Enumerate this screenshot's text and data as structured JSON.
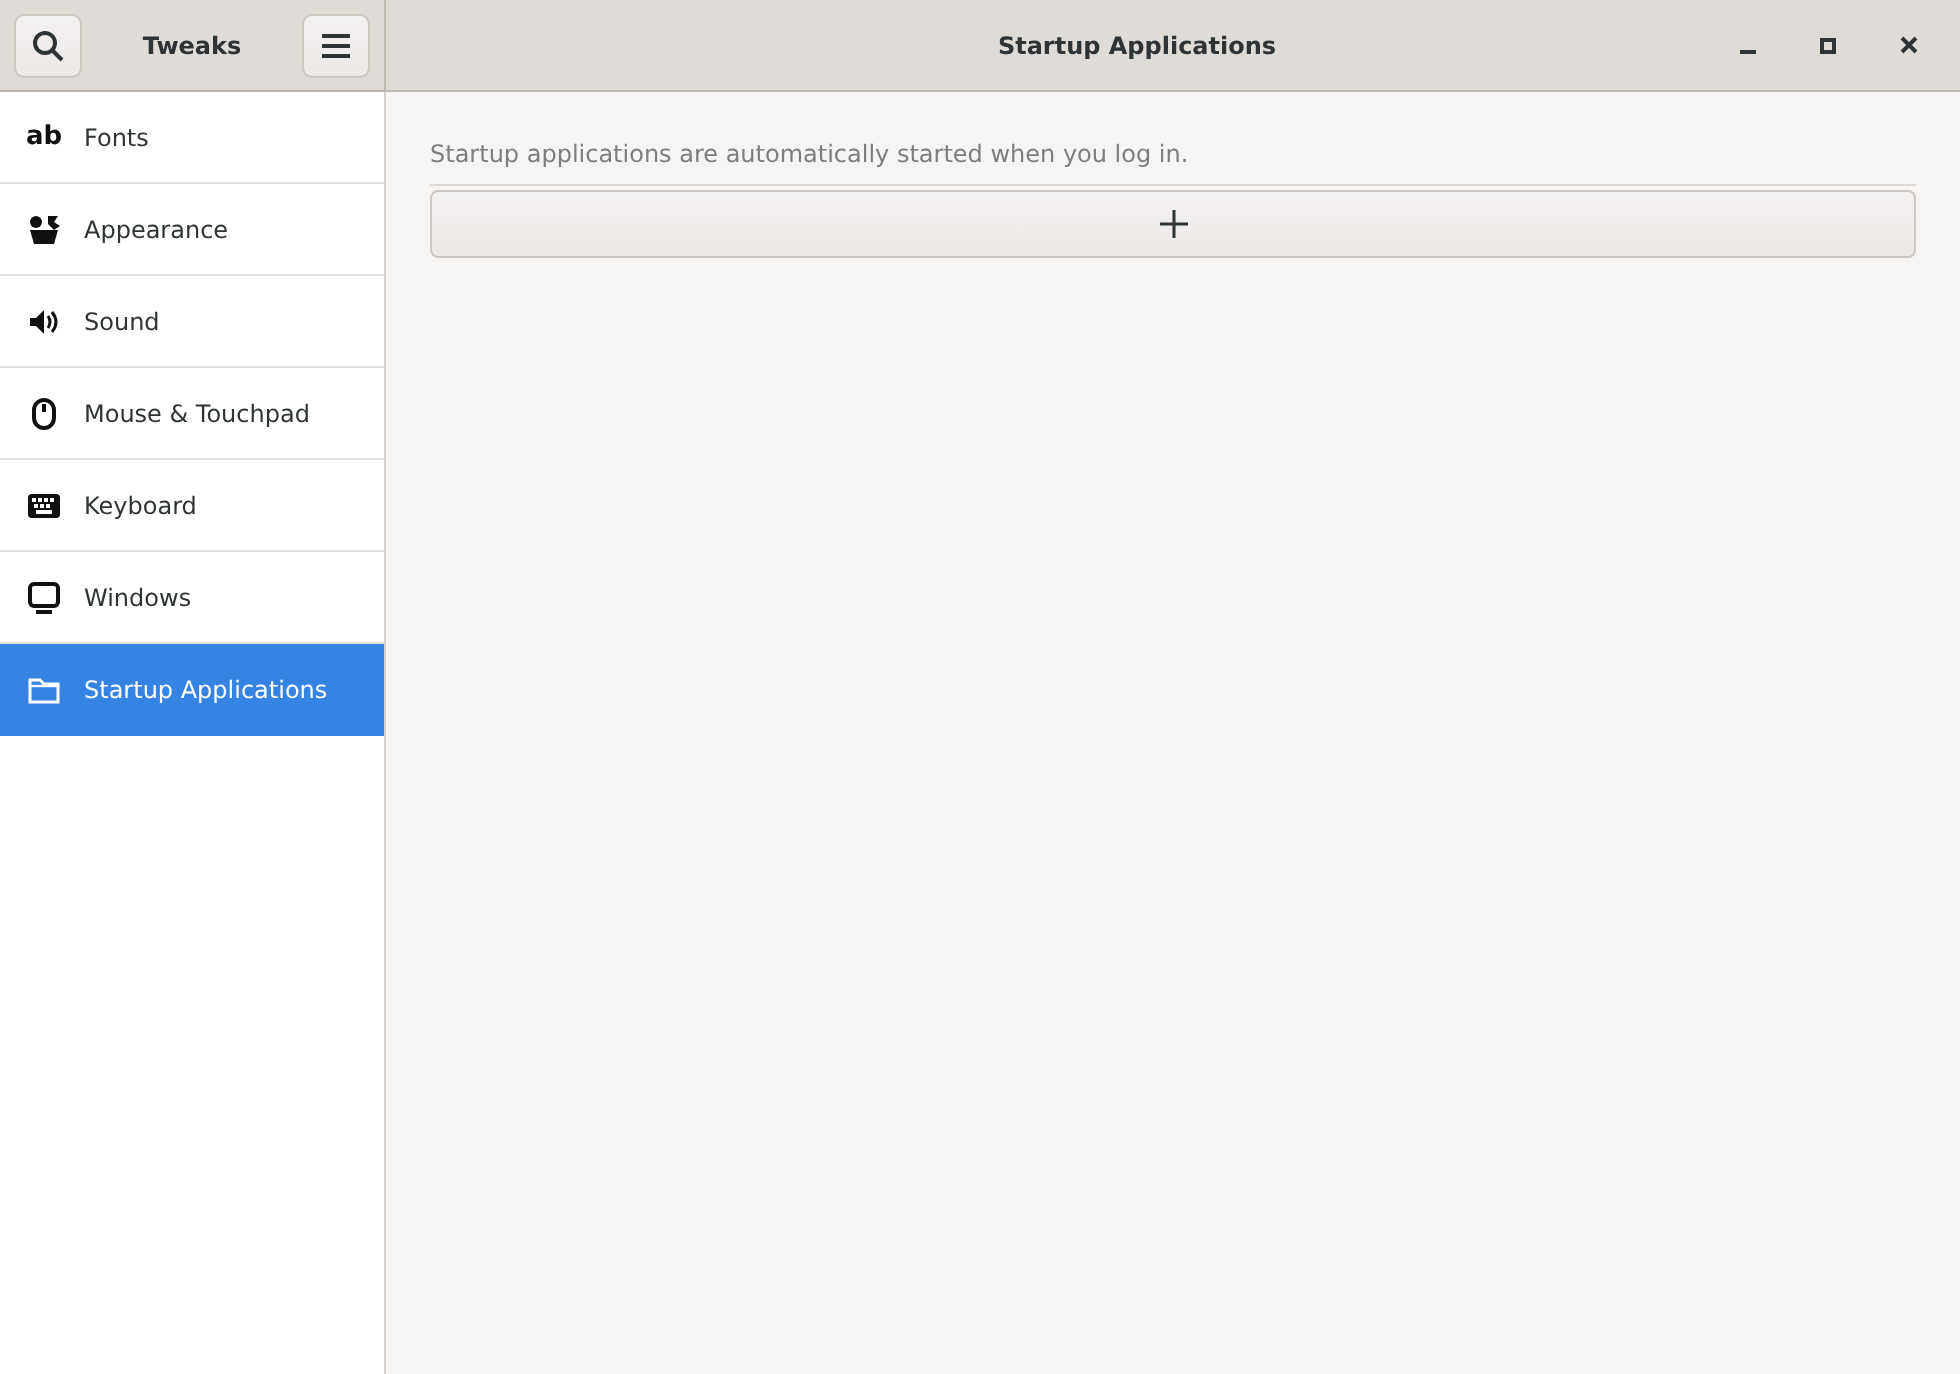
{
  "header": {
    "app_title": "Tweaks",
    "page_title": "Startup Applications"
  },
  "sidebar": {
    "items": [
      {
        "label": "Fonts",
        "selected": false,
        "glyph": "ab"
      },
      {
        "label": "Appearance",
        "selected": false
      },
      {
        "label": "Sound",
        "selected": false
      },
      {
        "label": "Mouse & Touchpad",
        "selected": false
      },
      {
        "label": "Keyboard",
        "selected": false
      },
      {
        "label": "Windows",
        "selected": false
      },
      {
        "label": "Startup Applications",
        "selected": true
      }
    ]
  },
  "content": {
    "description": "Startup applications are automatically started when you log in."
  }
}
